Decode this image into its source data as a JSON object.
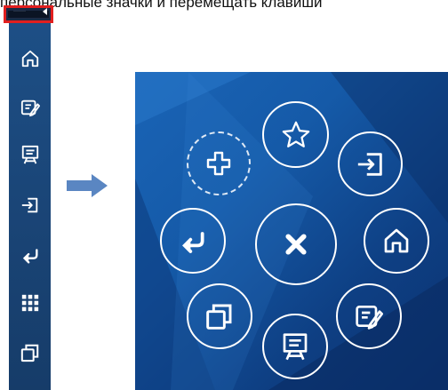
{
  "caption": "персональные значки и перемещать клавиши",
  "colors": {
    "sidebar_bg": "#1a4577",
    "highlight_border": "#e11f1f",
    "panel_bg": "#155aa8",
    "arrow": "#5a86c2",
    "icon": "#ffffff"
  },
  "sidebar": {
    "items": [
      {
        "icon": "home-icon"
      },
      {
        "icon": "edit-note-icon"
      },
      {
        "icon": "presentation-icon"
      },
      {
        "icon": "enter-icon"
      },
      {
        "icon": "return-icon"
      },
      {
        "icon": "grid-apps-icon"
      },
      {
        "icon": "windows-icon"
      }
    ]
  },
  "radial_menu": {
    "items": [
      {
        "icon": "add-icon",
        "style": "dashed"
      },
      {
        "icon": "star-icon"
      },
      {
        "icon": "enter-icon"
      },
      {
        "icon": "return-icon"
      },
      {
        "icon": "close-icon"
      },
      {
        "icon": "home-icon"
      },
      {
        "icon": "windows-icon"
      },
      {
        "icon": "presentation-icon"
      },
      {
        "icon": "edit-note-icon"
      }
    ]
  }
}
